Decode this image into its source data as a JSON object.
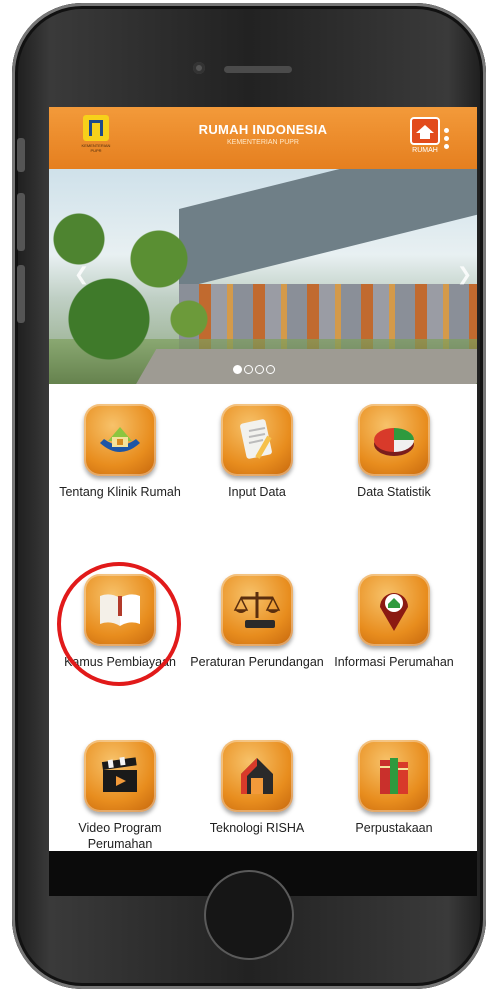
{
  "header": {
    "title": "RUMAH INDONESIA",
    "subtitle": "KEMENTERIAN PUPR",
    "logo_caption": "KEMENTERIAN PUPR",
    "right_icon_label": "RUMAH"
  },
  "banner": {
    "slide_count": 4,
    "active_slide": 1
  },
  "menu": [
    {
      "label": "Tentang Klinik Rumah",
      "icon": "house-hands-icon"
    },
    {
      "label": "Input Data",
      "icon": "document-pencil-icon"
    },
    {
      "label": "Data Statistik",
      "icon": "pie-chart-icon"
    },
    {
      "label": "Kamus Pembiayaan",
      "icon": "book-icon"
    },
    {
      "label": "Peraturan Perundangan",
      "icon": "scales-icon"
    },
    {
      "label": "Informasi Perumahan",
      "icon": "location-pin-icon"
    },
    {
      "label": "Video Program Perumahan",
      "icon": "clapperboard-icon"
    },
    {
      "label": "Teknologi RISHA",
      "icon": "house-frame-icon"
    },
    {
      "label": "Perpustakaan",
      "icon": "books-icon"
    }
  ],
  "colors": {
    "header": "#e88a26",
    "highlight": "#e11a1a"
  }
}
